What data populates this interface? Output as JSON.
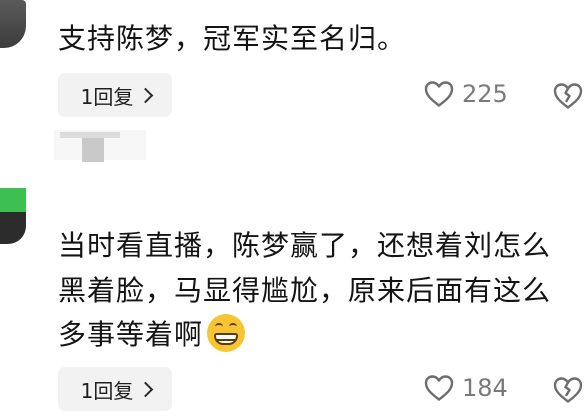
{
  "comments": [
    {
      "text_lines": [
        "支持陈梦，冠军实至名归。"
      ],
      "reply_label": "1回复",
      "like_count": "225"
    },
    {
      "text_lines": [
        "当时看直播，陈梦赢了，还想着刘怎么",
        "黑着脸，马显得尴尬，原来后面有这么",
        "多事等着啊"
      ],
      "emoji_name": "grinning-face-emoji",
      "reply_label": "1回复",
      "like_count": "184"
    }
  ],
  "colors": {
    "reply_pill_bg": "#f2f2f2",
    "like_count": "#7a7a7a",
    "text": "#141414"
  },
  "icons": [
    "heart-outline-icon",
    "broken-heart-outline-icon",
    "chevron-right-icon"
  ]
}
